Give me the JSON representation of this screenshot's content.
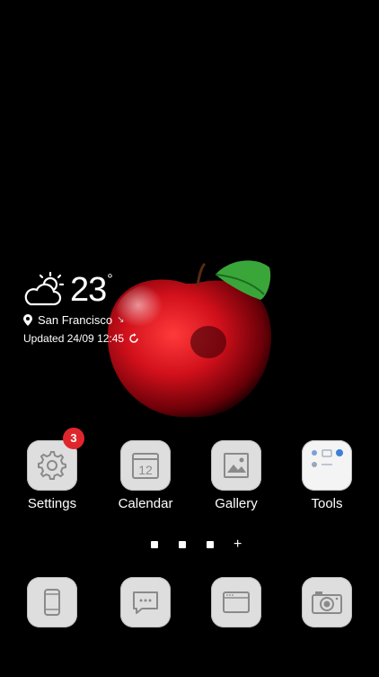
{
  "weather": {
    "temperature": "23",
    "unit": "°",
    "location": "San Francisco",
    "location_arrow": "↘",
    "updated": "Updated 24/09 12:45"
  },
  "apps": [
    {
      "label": "Settings",
      "icon": "gear-icon",
      "badge": "3"
    },
    {
      "label": "Calendar",
      "icon": "calendar-icon",
      "date": "12"
    },
    {
      "label": "Gallery",
      "icon": "image-icon"
    },
    {
      "label": "Tools",
      "icon": "tools-folder-icon"
    }
  ],
  "pager": {
    "pages": 3,
    "add_symbol": "+"
  },
  "dock": [
    {
      "icon": "phone-icon"
    },
    {
      "icon": "messages-icon"
    },
    {
      "icon": "browser-icon"
    },
    {
      "icon": "camera-icon"
    }
  ],
  "colors": {
    "background": "#000000",
    "icon_tile": "#dedede",
    "badge": "#e0262d",
    "apple_red": "#d1101b",
    "leaf_green": "#3aa63a"
  }
}
